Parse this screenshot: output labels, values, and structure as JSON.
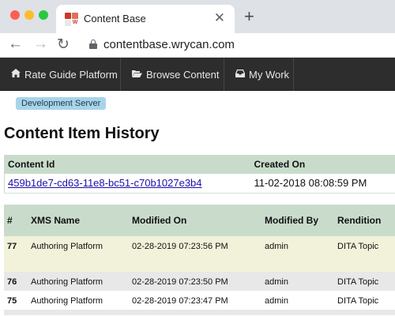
{
  "browser": {
    "tab_title": "Content Base",
    "favicon_letter": "W",
    "url": "contentbase.wrycan.com",
    "new_tab_icon": "plus-icon",
    "close_icon": "close-icon"
  },
  "nav": {
    "items": [
      {
        "label": "Rate Guide Platform",
        "icon": "home-icon"
      },
      {
        "label": "Browse Content",
        "icon": "folder-open-icon"
      },
      {
        "label": "My Work",
        "icon": "inbox-icon"
      }
    ]
  },
  "badge": "Development Server",
  "page_title": "Content Item History",
  "info": {
    "headers": {
      "content_id": "Content Id",
      "created_on": "Created On"
    },
    "content_id": "459b1de7-cd63-11e8-bc51-c70b1027e3b4",
    "created_on": "11-02-2018 08:08:59 PM"
  },
  "history": {
    "headers": {
      "num": "#",
      "xms_name": "XMS Name",
      "modified_on": "Modified On",
      "modified_by": "Modified By",
      "rendition": "Rendition"
    },
    "rows": [
      {
        "num": "77",
        "xms_name": "Authoring Platform",
        "modified_on": "02-28-2019 07:23:56 PM",
        "modified_by": "admin",
        "rendition": "DITA Topic"
      },
      {
        "num": "76",
        "xms_name": "Authoring Platform",
        "modified_on": "02-28-2019 07:23:50 PM",
        "modified_by": "admin",
        "rendition": "DITA Topic"
      },
      {
        "num": "75",
        "xms_name": "Authoring Platform",
        "modified_on": "02-28-2019 07:23:47 PM",
        "modified_by": "admin",
        "rendition": "DITA Topic"
      }
    ]
  },
  "colors": {
    "nav_bg": "#2d2d2d",
    "table_header_bg": "#c9dccb",
    "highlight_row_bg": "#f2f1d9",
    "badge_bg": "#a8d4ea",
    "link": "#1a0dab"
  }
}
